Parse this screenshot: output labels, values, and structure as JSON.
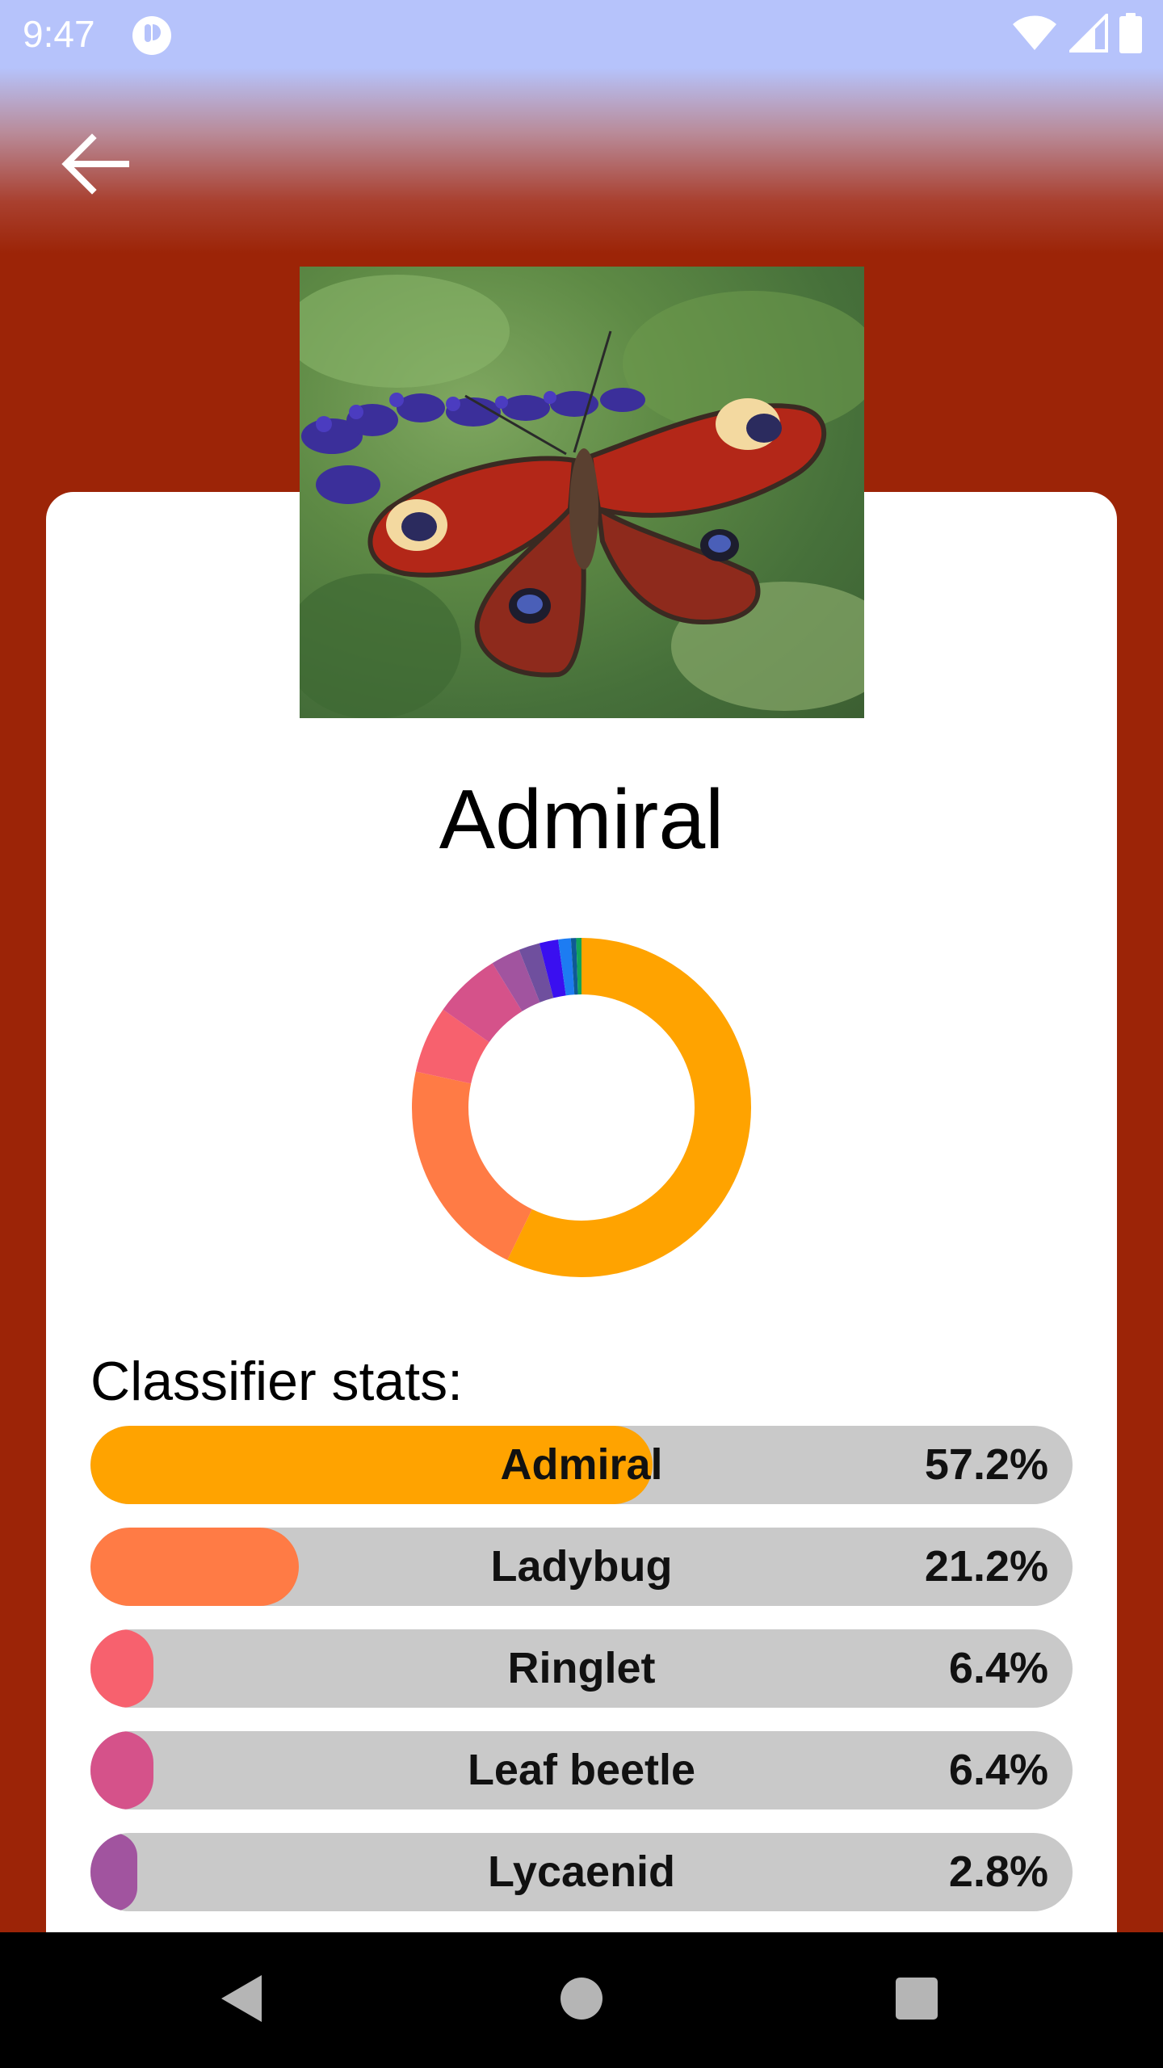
{
  "status_bar": {
    "time": "9:47",
    "icons": [
      "app-notification-icon",
      "wifi-icon",
      "cellular-signal-icon",
      "battery-icon"
    ]
  },
  "app_bar": {
    "back_icon": "arrow-left-icon"
  },
  "detail": {
    "photo_subject": "butterfly",
    "title": "Admiral"
  },
  "chart_data": {
    "type": "pie",
    "style": "donut",
    "categories": [
      "Admiral",
      "Ladybug",
      "Ringlet",
      "Leaf beetle",
      "Lycaenid",
      "other-1",
      "other-2",
      "other-3",
      "other-4",
      "other-5"
    ],
    "values": [
      57.2,
      21.2,
      6.4,
      6.4,
      2.8,
      2.0,
      1.8,
      1.2,
      0.5,
      0.5
    ],
    "colors": [
      "#ffa300",
      "#ff7b45",
      "#f7616e",
      "#d5528a",
      "#a1549f",
      "#6f4f9e",
      "#3a0ff0",
      "#1d7cf2",
      "#0e5a94",
      "#12a35a"
    ]
  },
  "stats": {
    "heading": "Classifier stats:",
    "rows": [
      {
        "label": "Admiral",
        "value": "57.2%",
        "fraction": 0.572,
        "color": "#ffa300"
      },
      {
        "label": "Ladybug",
        "value": "21.2%",
        "fraction": 0.212,
        "color": "#ff7b45"
      },
      {
        "label": "Ringlet",
        "value": "6.4%",
        "fraction": 0.064,
        "color": "#f7616e"
      },
      {
        "label": "Leaf beetle",
        "value": "6.4%",
        "fraction": 0.064,
        "color": "#d5528a"
      },
      {
        "label": "Lycaenid",
        "value": "2.8%",
        "fraction": 0.028,
        "color": "#a1549f"
      }
    ]
  },
  "nav_bar": {
    "buttons": [
      "back-triangle-icon",
      "home-circle-icon",
      "recents-square-icon"
    ]
  }
}
